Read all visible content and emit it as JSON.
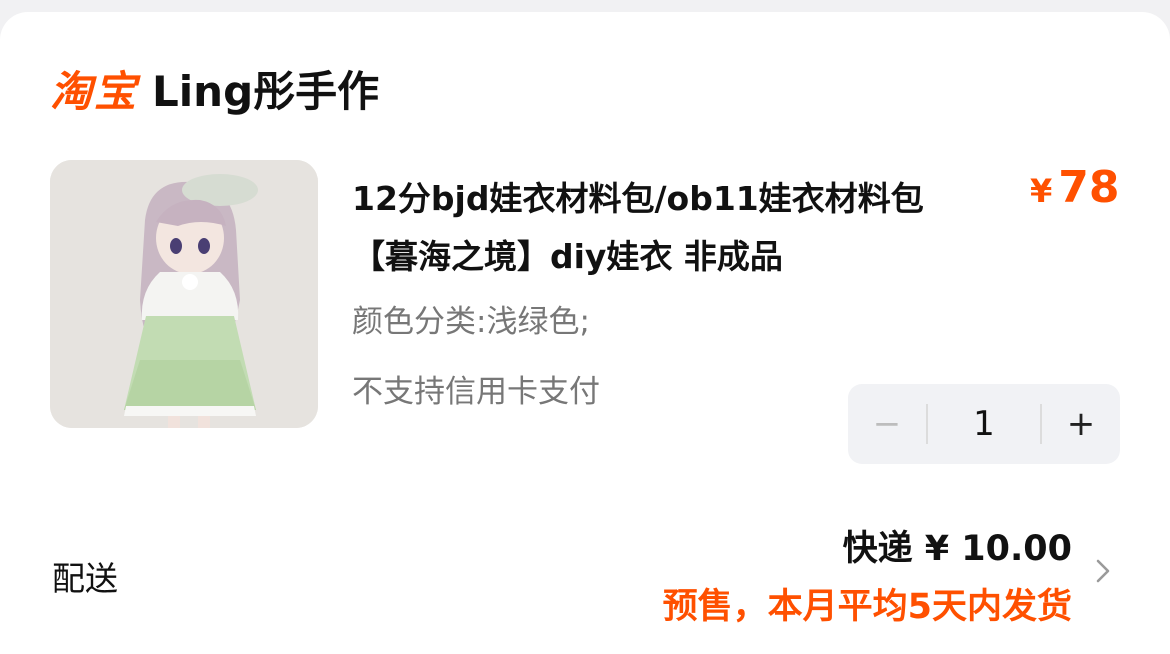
{
  "shop": {
    "platform_logo": "淘宝",
    "name": "Ling彤手作"
  },
  "item": {
    "title": "12分bjd娃衣材料包/ob11娃衣材料包【暮海之境】diy娃衣 非成品",
    "currency": "¥",
    "price": "78",
    "sku": "颜色分类:浅绿色;",
    "notice": "不支持信用卡支付",
    "thumbnail_icon": "doll-product-photo"
  },
  "quantity": {
    "minus": "−",
    "value": "1",
    "plus": "+"
  },
  "delivery": {
    "label": "配送",
    "fee": "快递 ¥ 10.00",
    "presale": "预售，本月平均5天内发货"
  },
  "colors": {
    "accent": "#ff5000",
    "muted": "#777777",
    "stepper_bg": "#f1f2f5"
  }
}
